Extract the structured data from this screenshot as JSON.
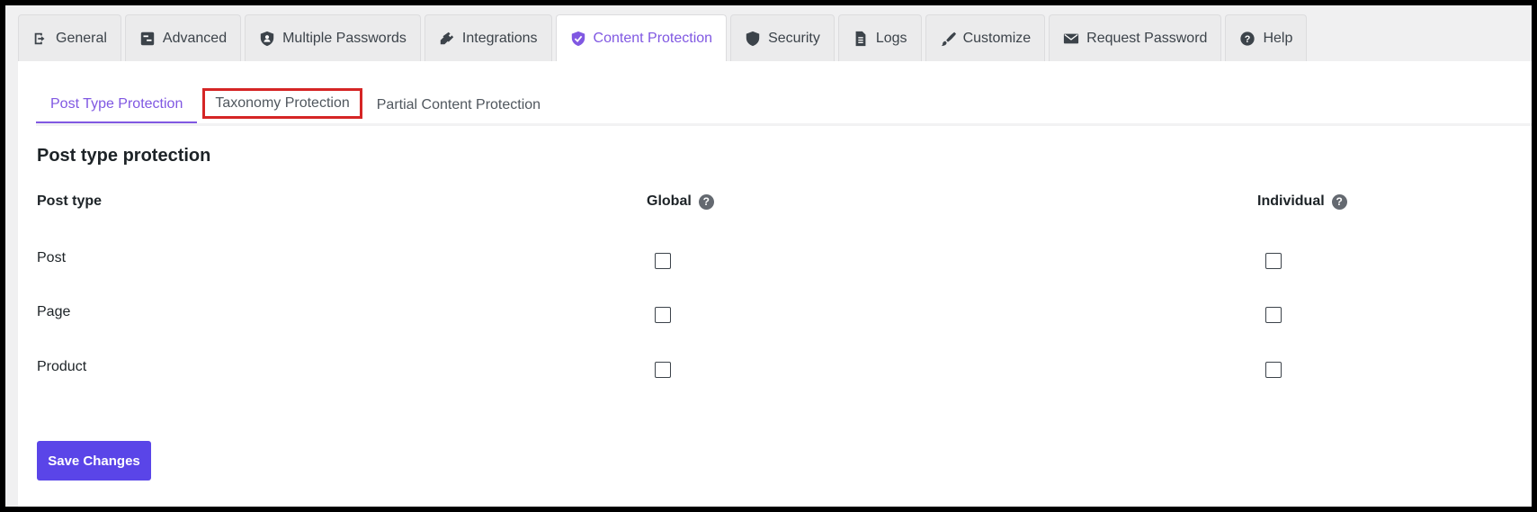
{
  "tabs": [
    {
      "label": "General",
      "icon": "exit-icon"
    },
    {
      "label": "Advanced",
      "icon": "advanced-icon"
    },
    {
      "label": "Multiple Passwords",
      "icon": "shield-users-icon"
    },
    {
      "label": "Integrations",
      "icon": "plug-icon"
    },
    {
      "label": "Content Protection",
      "icon": "shield-check-icon",
      "active": true
    },
    {
      "label": "Security",
      "icon": "shield-icon"
    },
    {
      "label": "Logs",
      "icon": "document-icon"
    },
    {
      "label": "Customize",
      "icon": "brush-icon"
    },
    {
      "label": "Request Password",
      "icon": "envelope-icon"
    },
    {
      "label": "Help",
      "icon": "help-icon"
    }
  ],
  "subtabs": [
    {
      "label": "Post Type Protection",
      "active": true
    },
    {
      "label": "Taxonomy Protection",
      "highlighted": true
    },
    {
      "label": "Partial Content Protection"
    }
  ],
  "section": {
    "title": "Post type protection",
    "columns": {
      "post_type": "Post type",
      "global": "Global",
      "individual": "Individual"
    },
    "rows": [
      {
        "label": "Post",
        "global": false,
        "individual": false
      },
      {
        "label": "Page",
        "global": false,
        "individual": false
      },
      {
        "label": "Product",
        "global": false,
        "individual": false
      }
    ]
  },
  "save_label": "Save Changes",
  "colors": {
    "accent": "#8058e2",
    "button": "#5a45e8",
    "highlight_outline": "#d52525"
  }
}
